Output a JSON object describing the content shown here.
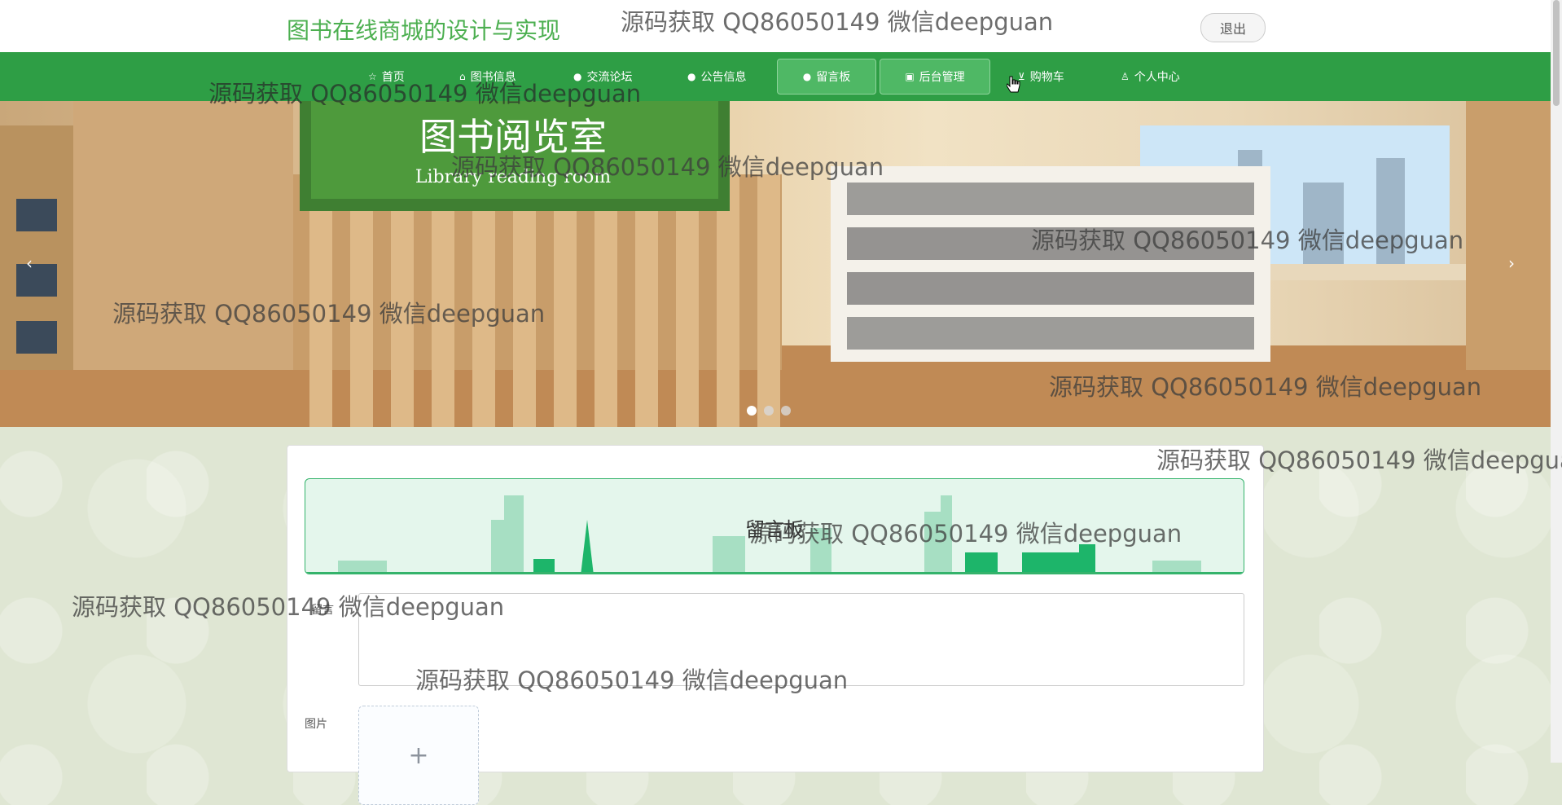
{
  "header": {
    "site_title": "图书在线商城的设计与实现",
    "logout_label": "退出"
  },
  "nav": {
    "items": [
      {
        "label": "首页",
        "icon": "home-icon",
        "glyph": "☆"
      },
      {
        "label": "图书信息",
        "icon": "book-icon",
        "glyph": "⌂"
      },
      {
        "label": "交流论坛",
        "icon": "forum-icon",
        "glyph": "●"
      },
      {
        "label": "公告信息",
        "icon": "notice-icon",
        "glyph": "●"
      },
      {
        "label": "留言板",
        "icon": "message-icon",
        "glyph": "●"
      },
      {
        "label": "后台管理",
        "icon": "admin-icon",
        "glyph": "▣"
      },
      {
        "label": "购物车",
        "icon": "cart-icon",
        "glyph": "⊻"
      },
      {
        "label": "个人中心",
        "icon": "user-icon",
        "glyph": "♙"
      }
    ],
    "active_index": 4,
    "nav_color": "#2e9e45"
  },
  "banner": {
    "sign_text_cn": "图书阅览室",
    "sign_text_en": "Library reading room",
    "dots": 3,
    "active_dot": 0
  },
  "board": {
    "title": "留言板",
    "content_label": "留言",
    "image_label": "图片",
    "upload_plus": "+"
  },
  "watermark": {
    "text": "源码获取 QQ86050149 微信deepguan"
  }
}
